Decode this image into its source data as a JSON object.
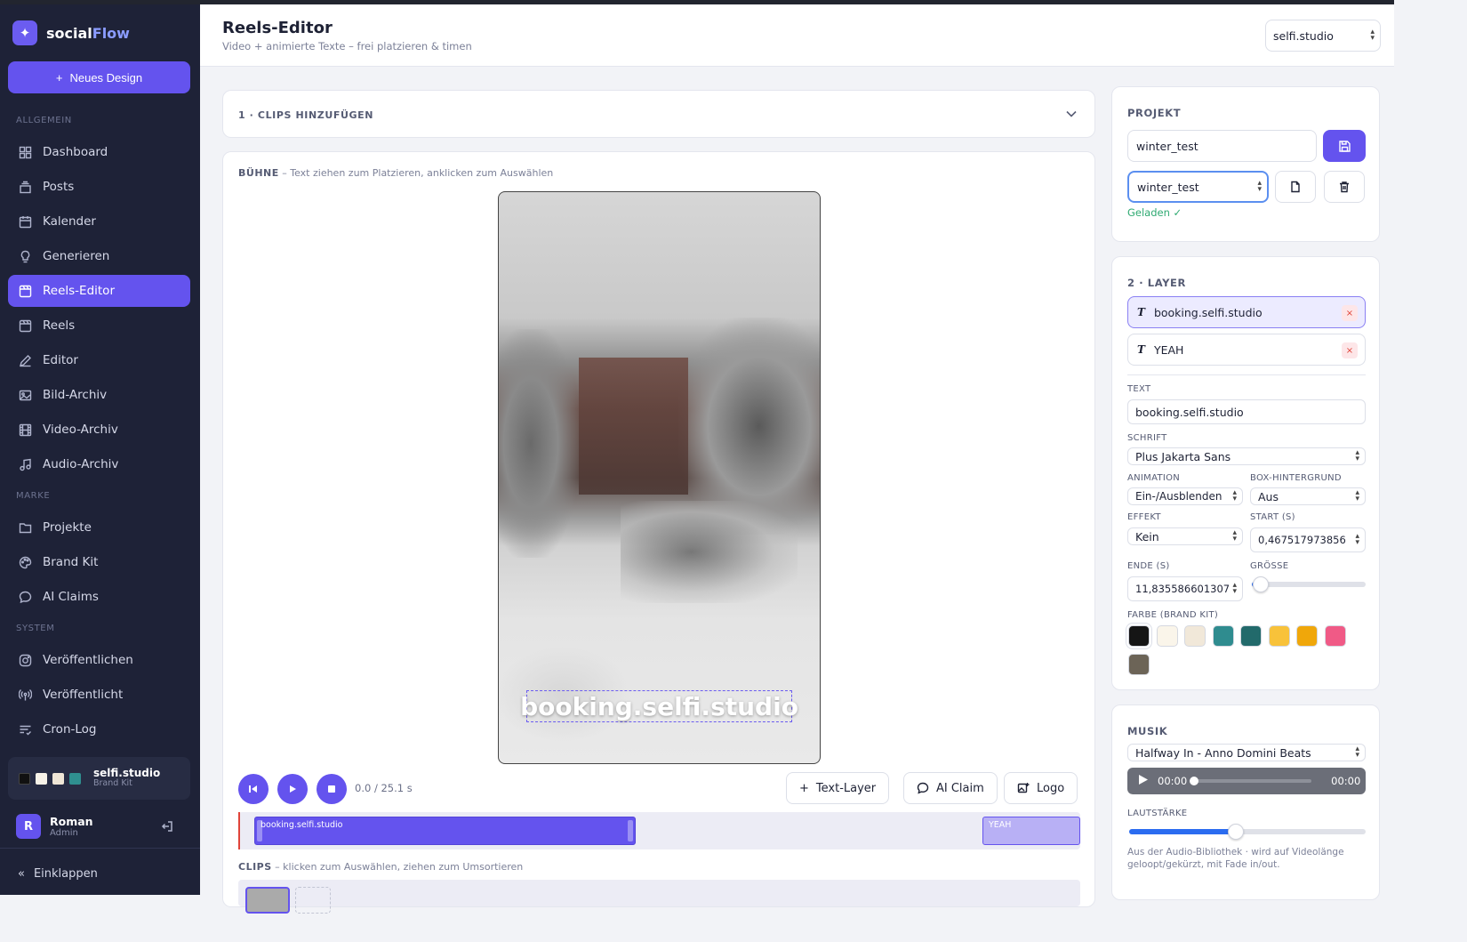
{
  "sidebar": {
    "brand": {
      "part1": "social",
      "part2": "Flow",
      "logo_icon": "✦"
    },
    "new_design": "Neues Design",
    "sections": {
      "general": "ALLGEMEIN",
      "brand": "MARKE",
      "system": "SYSTEM"
    },
    "items": [
      {
        "label": "Dashboard",
        "icon": "grid-icon"
      },
      {
        "label": "Posts",
        "icon": "stack-icon"
      },
      {
        "label": "Kalender",
        "icon": "calendar-icon"
      },
      {
        "label": "Generieren",
        "icon": "bulb-icon"
      },
      {
        "label": "Reels-Editor",
        "icon": "film-edit-icon",
        "active": true
      },
      {
        "label": "Reels",
        "icon": "film-icon"
      },
      {
        "label": "Editor",
        "icon": "pencil-icon"
      },
      {
        "label": "Bild-Archiv",
        "icon": "image-icon"
      },
      {
        "label": "Video-Archiv",
        "icon": "video-icon"
      },
      {
        "label": "Audio-Archiv",
        "icon": "music-icon"
      },
      {
        "label": "Projekte",
        "icon": "folder-icon"
      },
      {
        "label": "Brand Kit",
        "icon": "palette-icon"
      },
      {
        "label": "AI Claims",
        "icon": "chat-icon"
      },
      {
        "label": "Veröffentlichen",
        "icon": "instagram-icon"
      },
      {
        "label": "Veröffentlicht",
        "icon": "broadcast-icon"
      },
      {
        "label": "Cron-Log",
        "icon": "list-icon"
      }
    ],
    "brandkit": {
      "name": "selfi.studio",
      "sub": "Brand Kit",
      "colors": [
        "#111111",
        "#f7f2e8",
        "#efe6d6",
        "#2f8f8f"
      ]
    },
    "user": {
      "initial": "R",
      "name": "Roman",
      "role": "Admin"
    },
    "collapse": "Einklappen"
  },
  "header": {
    "title": "Reels-Editor",
    "subtitle": "Video + animierte Texte – frei platzieren & timen",
    "workspace": "selfi.studio"
  },
  "clips_section": {
    "title": "1 · CLIPS HINZUFÜGEN"
  },
  "stage": {
    "label_bold": "BÜHNE",
    "label_rest": " – Text ziehen zum Platzieren, anklicken zum Auswählen",
    "overlay_text": "booking.selfi.studio",
    "time": "0.0 / 25.1 s",
    "buttons": {
      "text_layer": "Text-Layer",
      "ai_claim": "AI Claim",
      "logo": "Logo"
    },
    "timeline": {
      "clip1": "booking.selfi.studio",
      "clip2": "YEAH"
    },
    "clips_label_bold": "CLIPS",
    "clips_label_rest": " – klicken zum Auswählen, ziehen zum Umsortieren"
  },
  "project": {
    "title": "PROJEKT",
    "name_value": "winter_test",
    "select_value": "winter_test",
    "status": "Geladen ✓"
  },
  "layers": {
    "title": "2 · LAYER",
    "items": [
      {
        "label": "booking.selfi.studio",
        "selected": true
      },
      {
        "label": "YEAH",
        "selected": false
      }
    ],
    "fields": {
      "text_label": "TEXT",
      "text_value": "booking.selfi.studio",
      "font_label": "SCHRIFT",
      "font_value": "Plus Jakarta Sans",
      "animation_label": "ANIMATION",
      "animation_value": "Ein-/Ausblenden",
      "box_bg_label": "BOX-HINTERGRUND",
      "box_bg_value": "Aus",
      "effect_label": "EFFEKT",
      "effect_value": "Kein",
      "start_label": "START (S)",
      "start_value": "0,467517973856",
      "end_label": "ENDE (S)",
      "end_value": "11,835586601307",
      "size_label": "GRÖSSE",
      "size_level": 0.08,
      "color_label": "FARBE (BRAND KIT)",
      "colors": [
        "#151515",
        "#faf5ea",
        "#f1e8d9",
        "#2f8c8f",
        "#226a6b",
        "#f8c23a",
        "#f0a70a",
        "#f05a86",
        "#6c6457"
      ]
    }
  },
  "music": {
    "title": "MUSIK",
    "track": "Halfway In - Anno Domini Beats",
    "current": "00:00",
    "duration": "00:00",
    "volume_label": "LAUTSTÄRKE",
    "volume_level": 0.45,
    "note": "Aus der Audio-Bibliothek · wird auf Videolänge geloopt/gekürzt, mit Fade in/out."
  }
}
